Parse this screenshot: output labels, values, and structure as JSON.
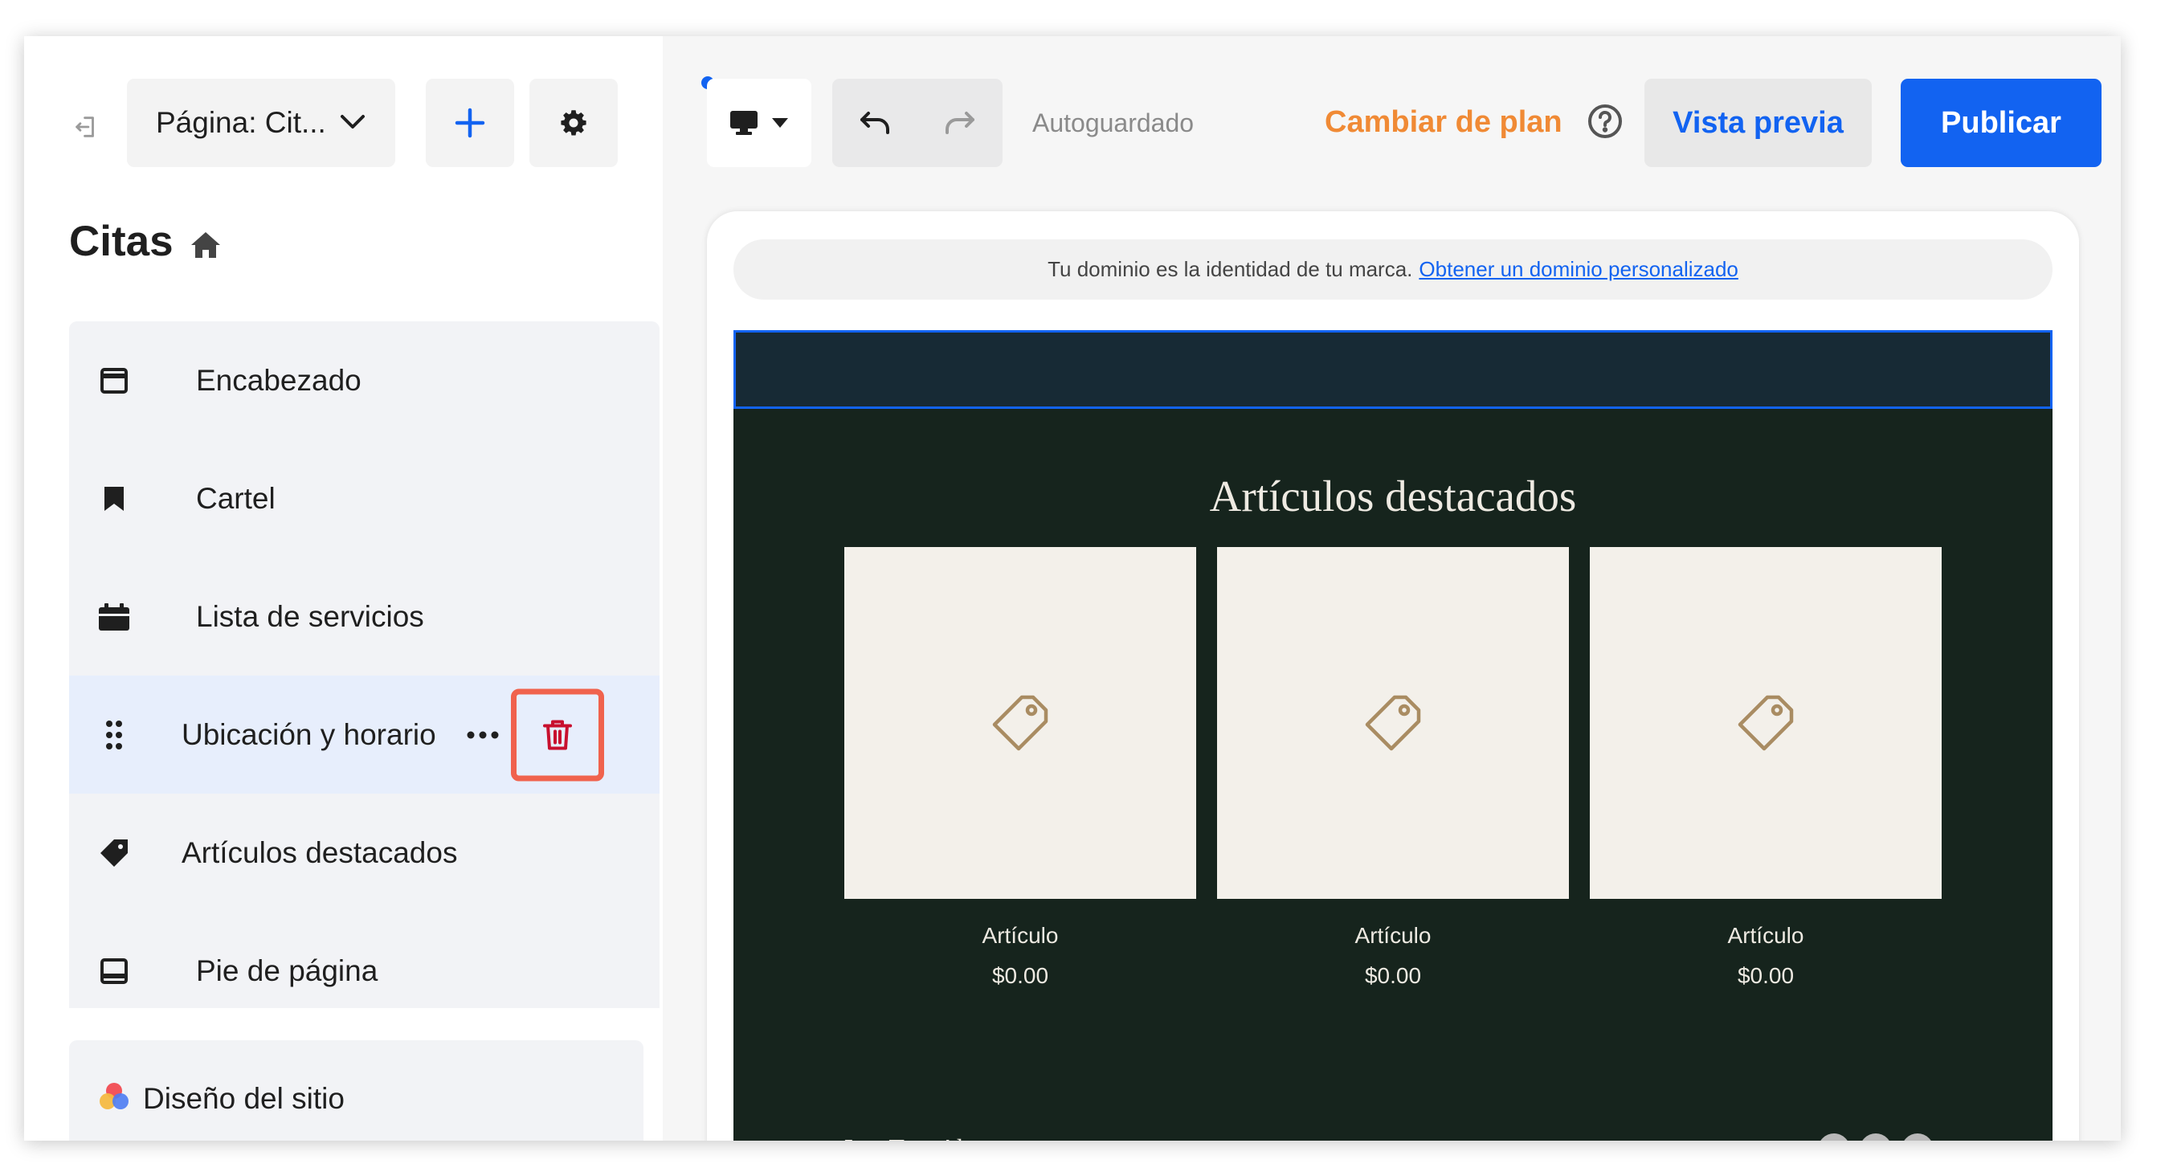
{
  "sidebar": {
    "page_select_label": "Página: Cit...",
    "page_title": "Citas",
    "sections": [
      {
        "label": "Encabezado"
      },
      {
        "label": "Cartel"
      },
      {
        "label": "Lista de servicios"
      },
      {
        "label": "Ubicación y horario"
      },
      {
        "label": "Artículos destacados"
      },
      {
        "label": "Pie de página"
      }
    ],
    "design_label": "Diseño del sitio"
  },
  "toolbar": {
    "autosave": "Autoguardado",
    "change_plan": "Cambiar de plan",
    "preview": "Vista previa",
    "publish": "Publicar"
  },
  "preview": {
    "domain_text": "Tu dominio es la identidad de tu marca.",
    "domain_link": "Obtener un dominio personalizado",
    "featured_title": "Artículos destacados",
    "products": [
      {
        "name": "Artículo",
        "price": "$0.00"
      },
      {
        "name": "Artículo",
        "price": "$0.00"
      },
      {
        "name": "Artículo",
        "price": "$0.00"
      }
    ],
    "footer_brand": "Los Tres Abetos"
  },
  "icons": {
    "exit": "exit-icon",
    "chevron": "chevron-down-icon",
    "add": "plus-icon",
    "settings": "gear-icon",
    "home": "home-icon",
    "drag": "drag-handle-icon",
    "more": "more-dots-icon",
    "trash": "trash-icon",
    "tag": "tag-icon",
    "desktop": "desktop-icon",
    "undo": "undo-icon",
    "redo": "redo-icon",
    "help": "help-circle-icon"
  },
  "colors": {
    "accent": "#1263f1",
    "plan": "#f08a35",
    "highlight": "#f0624d",
    "site_bg": "#16241d",
    "header_bg": "#172a35",
    "tag": "#a98c62"
  }
}
